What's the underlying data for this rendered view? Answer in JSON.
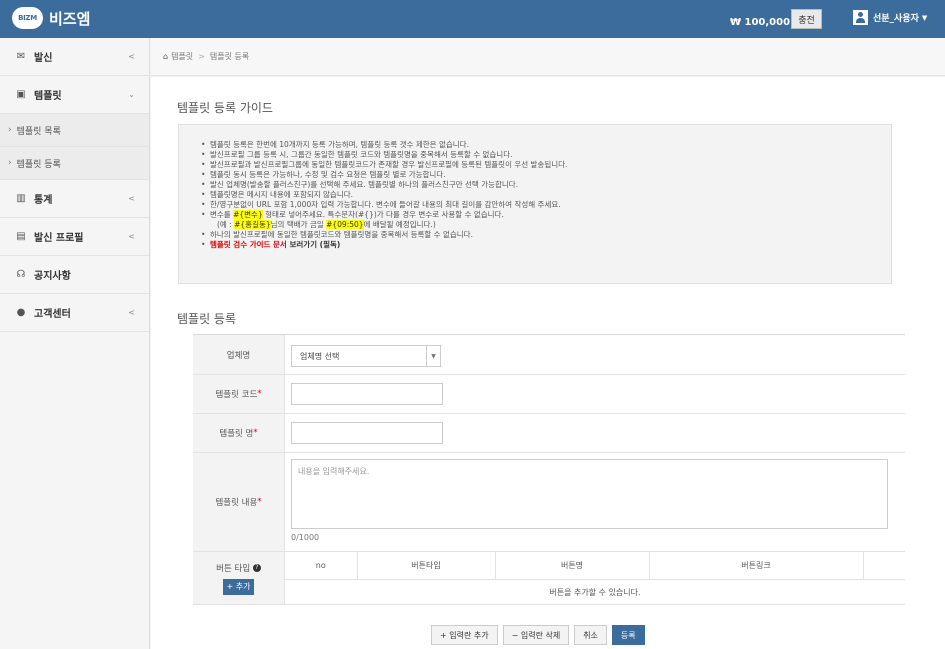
{
  "app": {
    "logo_badge": "BIZM",
    "name": "비즈엠"
  },
  "header": {
    "balance": "₩ 100,000 원",
    "charge_label": "충전",
    "user_name": "선분_사용자"
  },
  "sidebar": {
    "items": [
      {
        "label": "발신"
      },
      {
        "label": "템플릿"
      },
      {
        "label": "통계"
      },
      {
        "label": "발신 프로필"
      },
      {
        "label": "공지사항"
      },
      {
        "label": "고객센터"
      }
    ],
    "subitems": [
      {
        "label": "템플릿 목록"
      },
      {
        "label": "템플릿 등록"
      }
    ]
  },
  "breadcrumb": {
    "home": "템플릿",
    "current": "템플릿 등록"
  },
  "guide": {
    "title": "템플릿 등록 가이드",
    "lines": [
      "템플릿 등록은 한번에 10개까지 등록 가능하며, 템플릿 등록 갯수 제한은 없습니다.",
      "발신프로필 그룹 등록 시, 그룹간 동일한 템플릿 코드와 템플릿명을 중복해서 등록할 수 없습니다.",
      "발신프로필과 발신프로필그룹에 동일한 템플릿코드가 존재할 경우 발신프로필에 등록된 템플릿이 우선 발송됩니다.",
      "템플릿 동시 등록은 가능하나, 수정 및 검수 요청은 템플릿 별로 가능합니다.",
      "발신 업체명(발송할 플러스친구)를 선택해 주세요. 템플릿별 하나의 플러스친구만 선택 가능합니다.",
      "템플릿명은 메시지 내용에 포함되지 않습니다.",
      "한/영구분없이 URL 포함 1,000자 입력 가능합니다. 변수에 들어갈 내용의 최대 길이를 감안하여 작성해 주세요."
    ],
    "var_line": {
      "pre": "변수를 ",
      "var": "#{변수}",
      "post": " 형태로 넣어주세요. 특수문자(#{})가 다를 경우 변수로 사용할 수 없습니다."
    },
    "example": {
      "pre": "(예 : ",
      "v1": "#{홍길동}",
      "mid": "님의 택배가 금일 ",
      "v2": "#{09:50}",
      "post": "에 배달될 예정입니다.)"
    },
    "dup_line": "하나의 발신프로필에 동일한 템플릿코드와 템플릿명을 중복해서 등록할 수 없습니다.",
    "link": {
      "red": "템플릿 검수 가이드 문서",
      "rest": " 보러가기 (필독)"
    }
  },
  "form": {
    "title": "템플릿 등록",
    "company_label": "업체명",
    "company_value": "업체명 선택",
    "code_label": "템플릿 코드",
    "name_label": "템플릿 명",
    "content_label": "템플릿 내용",
    "required_mark": "*",
    "content_placeholder": "내용을 입력해주세요.",
    "char_count": "0/1000",
    "button_type_label": "버튼 타입",
    "add_label": "+ 추가",
    "columns": [
      "no",
      "버튼타입",
      "버튼명",
      "버튼링크",
      ""
    ],
    "empty_message": "버튼을 추가할 수 있습니다."
  },
  "actions": {
    "add_row": "+ 입력란 추가",
    "delete_row": "− 입력란 삭제",
    "cancel": "취소",
    "submit": "등록"
  }
}
